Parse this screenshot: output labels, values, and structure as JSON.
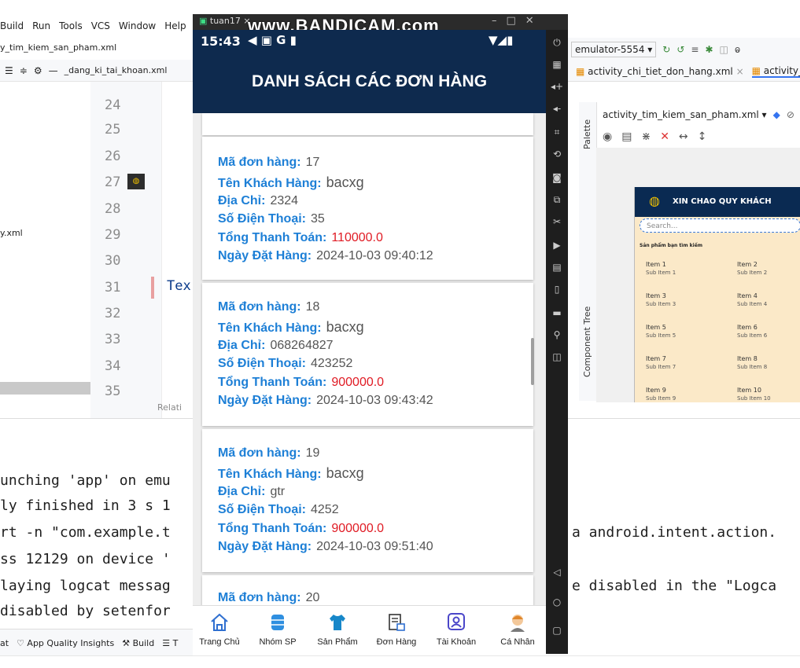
{
  "ide": {
    "menu": [
      "Build",
      "Run",
      "Tools",
      "VCS",
      "Window",
      "Help"
    ],
    "breadcrumb": "y_tim_kiem_san_pham.xml",
    "left_tab": "_dang_ki_tai_khoan.xml",
    "left_file": "y.xml",
    "line_numbers": [
      "24",
      "25",
      "26",
      "27",
      "28",
      "29",
      "30",
      "31",
      "32",
      "33",
      "34",
      "35"
    ],
    "code_fragment": "Tex",
    "status_hint": "Relati",
    "console_lines": [
      "unching 'app' on emu",
      "ly finished in 3 s 1",
      "rt -n \"com.example.t",
      "ss 12129 on device '",
      "laying logcat messag",
      "disabled by setenfor"
    ],
    "console_right": [
      "a android.intent.action.",
      "e disabled in the \"Logca"
    ],
    "bottom_tools": [
      "at",
      "App Quality Insights",
      "Build",
      "T"
    ],
    "device_selector": "emulator-5554",
    "file_tabs": [
      "activity_chi_tiet_don_hang.xml",
      "activity_tim"
    ],
    "palette_label": "Palette",
    "component_tree_label": "Component Tree",
    "design_file": "activity_tim_kiem_san_pham.xml"
  },
  "preview": {
    "title": "XIN CHAO QUY KHÁCH",
    "search_placeholder": "Search...",
    "section_label": "Sản phẩm bạn tìm kiếm",
    "items": [
      {
        "title": "Item 1",
        "sub": "Sub Item 1"
      },
      {
        "title": "Item 2",
        "sub": "Sub Item 2"
      },
      {
        "title": "Item 3",
        "sub": "Sub Item 3"
      },
      {
        "title": "Item 4",
        "sub": "Sub Item 4"
      },
      {
        "title": "Item 5",
        "sub": "Sub Item 5"
      },
      {
        "title": "Item 6",
        "sub": "Sub Item 6"
      },
      {
        "title": "Item 7",
        "sub": "Sub Item 7"
      },
      {
        "title": "Item 8",
        "sub": "Sub Item 8"
      },
      {
        "title": "Item 9",
        "sub": "Sub Item 9"
      },
      {
        "title": "Item 10",
        "sub": "Sub Item 10"
      }
    ]
  },
  "emulator": {
    "window_title": "tuan17",
    "watermark": "www.BANDICAM.com",
    "time": "15:43",
    "app_title": "DANH SÁCH CÁC ĐƠN HÀNG",
    "labels": {
      "order_id": "Mã đơn hàng:",
      "customer": "Tên Khách Hàng:",
      "address": "Địa Chỉ:",
      "phone": "Số Điện Thoại:",
      "total": "Tổng Thanh Toán:",
      "date": "Ngày Đặt Hàng:"
    },
    "orders": [
      {
        "id": "17",
        "customer": "bacxg",
        "address": "2324",
        "phone": "35",
        "total": "110000.0",
        "date": "2024-10-03 09:40:12"
      },
      {
        "id": "18",
        "customer": "bacxg",
        "address": "068264827",
        "phone": "423252",
        "total": "900000.0",
        "date": "2024-10-03 09:43:42"
      },
      {
        "id": "19",
        "customer": "bacxg",
        "address": "gtr",
        "phone": "4252",
        "total": "900000.0",
        "date": "2024-10-03 09:51:40"
      },
      {
        "id": "20"
      }
    ],
    "nav": [
      {
        "label": "Trang Chủ",
        "icon": "home-icon"
      },
      {
        "label": "Nhóm SP",
        "icon": "database-icon"
      },
      {
        "label": "Sản Phẩm",
        "icon": "shirt-icon"
      },
      {
        "label": "Đơn Hàng",
        "icon": "order-icon"
      },
      {
        "label": "Tài Khoản",
        "icon": "account-icon"
      },
      {
        "label": "Cá Nhân",
        "icon": "avatar-icon"
      }
    ]
  },
  "colors": {
    "app_bar": "#0e2a4e",
    "label_blue": "#1d7fd6",
    "total_red": "#e01b24"
  }
}
